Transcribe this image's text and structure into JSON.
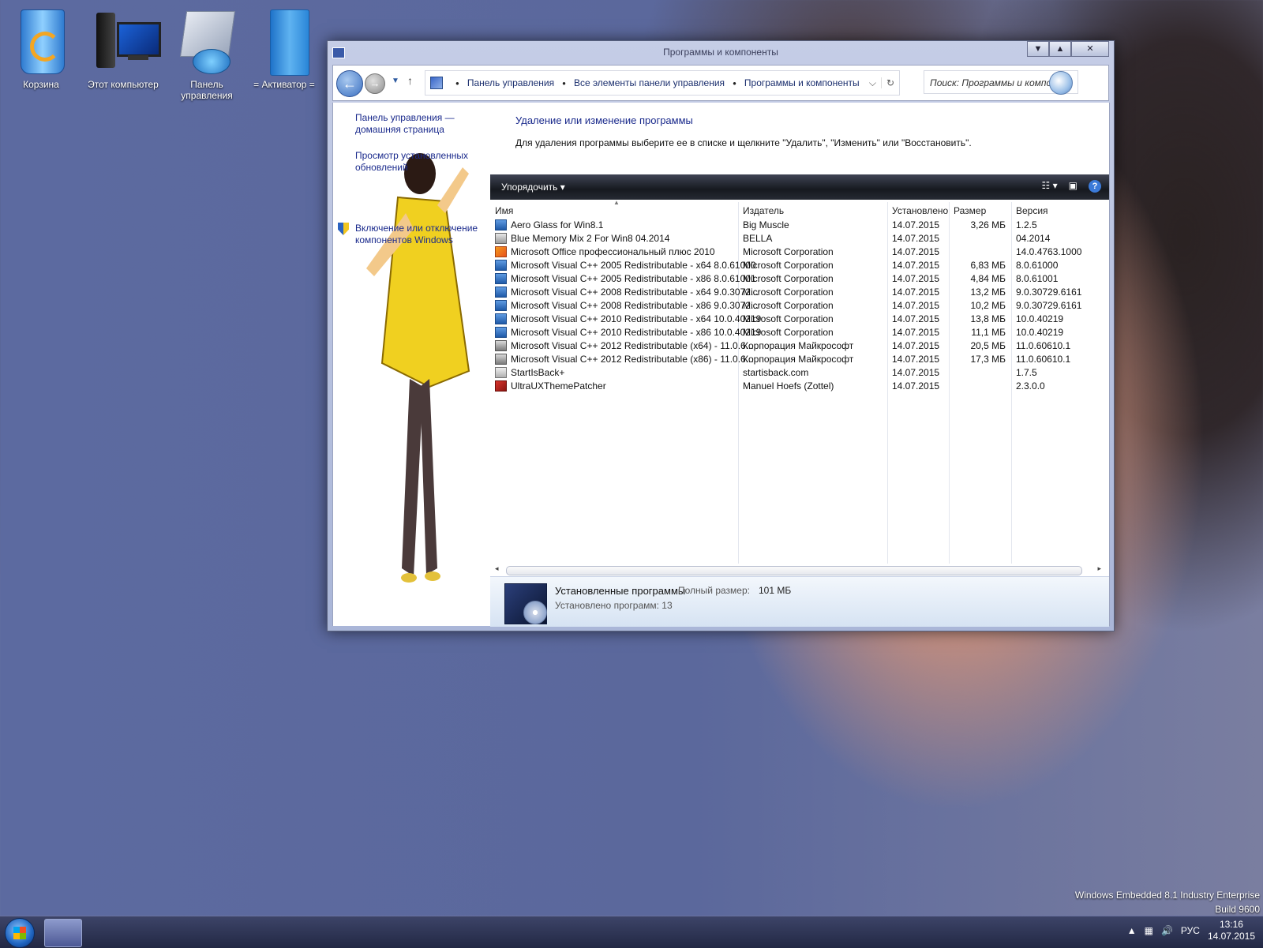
{
  "desktop": {
    "icons": [
      {
        "label": "Корзина",
        "icon": "recycle-bin-icon"
      },
      {
        "label": "Этот компьютер",
        "icon": "computer-icon"
      },
      {
        "label": "Панель управления",
        "icon": "control-panel-icon"
      },
      {
        "label": "= Активатор =",
        "icon": "folder-icon"
      }
    ],
    "watermark": {
      "line1": "Windows Embedded 8.1 Industry Enterprise",
      "line2": "Build 9600"
    }
  },
  "window": {
    "title": "Программы и компоненты",
    "caption_buttons": {
      "minimize": "▼",
      "maximize": "▲",
      "close": "✕"
    },
    "breadcrumb": [
      "Панель управления",
      "Все элементы панели управления",
      "Программы и компоненты"
    ],
    "search": {
      "placeholder": "Поиск: Программы и компо..."
    }
  },
  "sidebar": {
    "links": [
      {
        "label": "Панель управления — домашняя страница"
      },
      {
        "label": "Просмотр установленных обновлений"
      },
      {
        "label": "Включение или отключение компонентов Windows"
      }
    ]
  },
  "main": {
    "heading": "Удаление или изменение программы",
    "description": "Для удаления программы выберите ее в списке и щелкните \"Удалить\", \"Изменить\" или \"Восстановить\".",
    "toolbar": {
      "organize": "Упорядочить",
      "help": "?"
    },
    "columns": {
      "name": "Имя",
      "publisher": "Издатель",
      "installed": "Установлено",
      "size": "Размер",
      "version": "Версия"
    },
    "programs": [
      {
        "name": "Aero Glass for Win8.1",
        "publisher": "Big Muscle",
        "installed": "14.07.2015",
        "size": "3,26 МБ",
        "version": "1.2.5"
      },
      {
        "name": "Blue Memory Mix 2 For Win8 04.2014",
        "publisher": "BELLA",
        "installed": "14.07.2015",
        "size": "",
        "version": "04.2014"
      },
      {
        "name": "Microsoft Office профессиональный плюс 2010",
        "publisher": "Microsoft Corporation",
        "installed": "14.07.2015",
        "size": "",
        "version": "14.0.4763.1000"
      },
      {
        "name": "Microsoft Visual C++ 2005 Redistributable - x64 8.0.61000",
        "publisher": "Microsoft Corporation",
        "installed": "14.07.2015",
        "size": "6,83 МБ",
        "version": "8.0.61000"
      },
      {
        "name": "Microsoft Visual C++ 2005 Redistributable - x86 8.0.61001",
        "publisher": "Microsoft Corporation",
        "installed": "14.07.2015",
        "size": "4,84 МБ",
        "version": "8.0.61001"
      },
      {
        "name": "Microsoft Visual C++ 2008 Redistributable - x64 9.0.3072...",
        "publisher": "Microsoft Corporation",
        "installed": "14.07.2015",
        "size": "13,2 МБ",
        "version": "9.0.30729.6161"
      },
      {
        "name": "Microsoft Visual C++ 2008 Redistributable - x86 9.0.3072...",
        "publisher": "Microsoft Corporation",
        "installed": "14.07.2015",
        "size": "10,2 МБ",
        "version": "9.0.30729.6161"
      },
      {
        "name": "Microsoft Visual C++ 2010 Redistributable - x64 10.0.40219",
        "publisher": "Microsoft Corporation",
        "installed": "14.07.2015",
        "size": "13,8 МБ",
        "version": "10.0.40219"
      },
      {
        "name": "Microsoft Visual C++ 2010 Redistributable - x86 10.0.40219",
        "publisher": "Microsoft Corporation",
        "installed": "14.07.2015",
        "size": "11,1 МБ",
        "version": "10.0.40219"
      },
      {
        "name": "Microsoft Visual C++ 2012 Redistributable (x64) - 11.0.6...",
        "publisher": "Корпорация Майкрософт",
        "installed": "14.07.2015",
        "size": "20,5 МБ",
        "version": "11.0.60610.1"
      },
      {
        "name": "Microsoft Visual C++ 2012 Redistributable (x86) - 11.0.6...",
        "publisher": "Корпорация Майкрософт",
        "installed": "14.07.2015",
        "size": "17,3 МБ",
        "version": "11.0.60610.1"
      },
      {
        "name": "StartIsBack+",
        "publisher": "startisback.com",
        "installed": "14.07.2015",
        "size": "",
        "version": "1.7.5"
      },
      {
        "name": "UltraUXThemePatcher",
        "publisher": "Manuel Hoefs (Zottel)",
        "installed": "14.07.2015",
        "size": "",
        "version": "2.3.0.0"
      }
    ],
    "details": {
      "title": "Установленные программы",
      "total_label": "Полный размер:",
      "total_value": "101 МБ",
      "count_text": "Установлено программ: 13"
    }
  },
  "taskbar": {
    "language": "РУС",
    "time": "13:16",
    "date": "14.07.2015"
  }
}
